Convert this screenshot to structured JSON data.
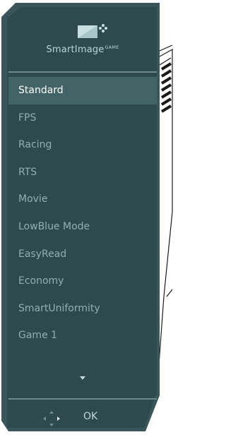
{
  "header": {
    "brand": "SmartImage",
    "brand_sup": "GAME"
  },
  "menu": {
    "items": [
      {
        "label": "Standard",
        "selected": true
      },
      {
        "label": "FPS"
      },
      {
        "label": "Racing"
      },
      {
        "label": "RTS"
      },
      {
        "label": "Movie"
      },
      {
        "label": "LowBlue Mode"
      },
      {
        "label": "EasyRead"
      },
      {
        "label": "Economy"
      },
      {
        "label": "SmartUniformity"
      },
      {
        "label": "Game 1"
      }
    ]
  },
  "footer": {
    "ok_label": "OK",
    "nav_icon": "four-way-navigation-icon",
    "scroll_icon": "down-arrow-icon"
  },
  "colors": {
    "panel": "#2e4a4f",
    "selected": "#426466",
    "text": "#8fb0b3",
    "selected_text": "#ffffff"
  }
}
